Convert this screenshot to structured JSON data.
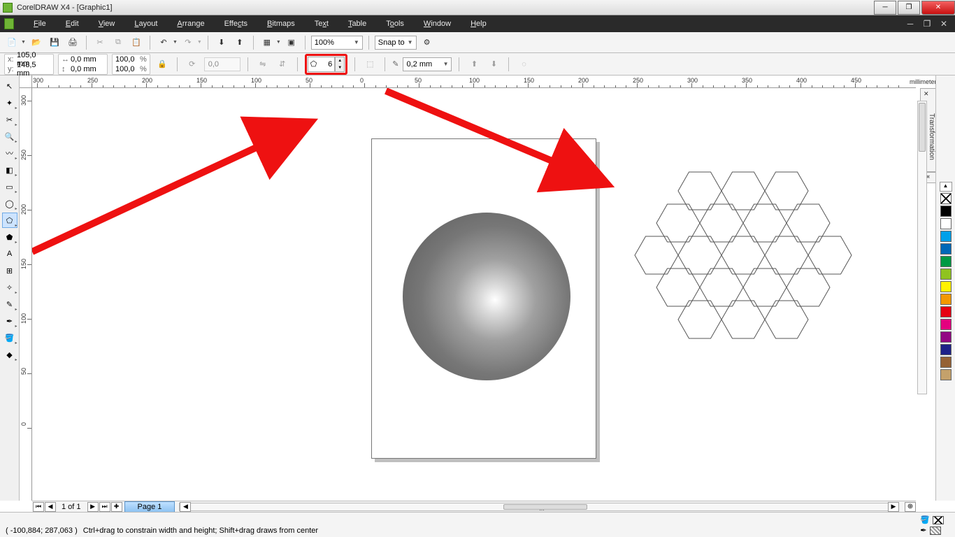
{
  "title": "CorelDRAW X4 - [Graphic1]",
  "menu": [
    "File",
    "Edit",
    "View",
    "Layout",
    "Arrange",
    "Effects",
    "Bitmaps",
    "Text",
    "Table",
    "Tools",
    "Window",
    "Help"
  ],
  "zoom": "100%",
  "snap": "Snap to",
  "prop": {
    "x": "105,0 mm",
    "y": "148,5 mm",
    "w": "0,0 mm",
    "h": "0,0 mm",
    "sx": "100,0",
    "sy": "100,0",
    "rot": "0,0",
    "sides": "6",
    "outline": "0,2 mm"
  },
  "ruler_unit": "millimeters",
  "ruler_h": [
    "300",
    "250",
    "200",
    "150",
    "100",
    "50",
    "0",
    "50",
    "100",
    "150",
    "200",
    "250",
    "300",
    "350",
    "400",
    "450"
  ],
  "ruler_v": [
    "300",
    "250",
    "200",
    "150",
    "100",
    "50",
    "0"
  ],
  "page_nav": "1 of 1",
  "page_tab": "Page 1",
  "status": {
    "coords": "( -100,884; 287,063 )",
    "hint": "Ctrl+drag to constrain width and height; Shift+drag draws from center"
  },
  "docker": "Transformation",
  "palette": [
    "#000000",
    "#ffffff",
    "#00a0e9",
    "#0068b7",
    "#009944",
    "#8fc31f",
    "#fff100",
    "#f39800",
    "#e60012",
    "#e4007f",
    "#920783",
    "#1d2088",
    "#956134",
    "#c4a16b"
  ]
}
